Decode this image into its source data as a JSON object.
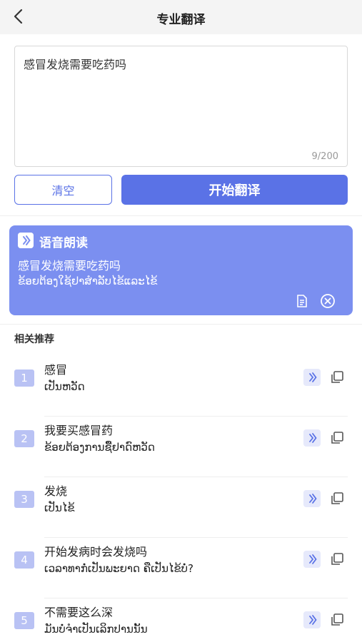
{
  "header": {
    "title": "专业翻译",
    "back_icon": "chevron-left-icon"
  },
  "input": {
    "value": "感冒发烧需要吃药吗",
    "count": "9/200"
  },
  "buttons": {
    "clear": "清空",
    "start": "开始翻译"
  },
  "result": {
    "title": "语音朗读",
    "source": "感冒发烧需要吃药吗",
    "translation": "ຂ້ອຍຕ້ອງໃຊ້ຢາສໍາລັບໄຂ້ແລະໄຂ້",
    "icons": [
      "document-icon",
      "close-circle-icon"
    ]
  },
  "recommend": {
    "title": "相关推荐",
    "items": [
      {
        "num": "1",
        "zh": "感冒",
        "lo": "ເປັນຫວັດ"
      },
      {
        "num": "2",
        "zh": "我要买感冒药",
        "lo": "ຂ້ອຍຕ້ອງການຊື້ຢາດົຫວັດ"
      },
      {
        "num": "3",
        "zh": "发烧",
        "lo": "ເປັນໄຂ້"
      },
      {
        "num": "4",
        "zh": "开始发病时会发烧吗",
        "lo": "ເວລາທາກໍ່ເປັນພະຍາດ ຄືເປັນໄຂ້ບໍ່?"
      },
      {
        "num": "5",
        "zh": "不需要这么深",
        "lo": "ມັນບໍ່ຈໍາເປັນເລິກປານນັ້ນ"
      }
    ]
  },
  "colors": {
    "accent": "#5a72e6",
    "card": "#7b8ff0",
    "badge": "#b9c2f4"
  }
}
